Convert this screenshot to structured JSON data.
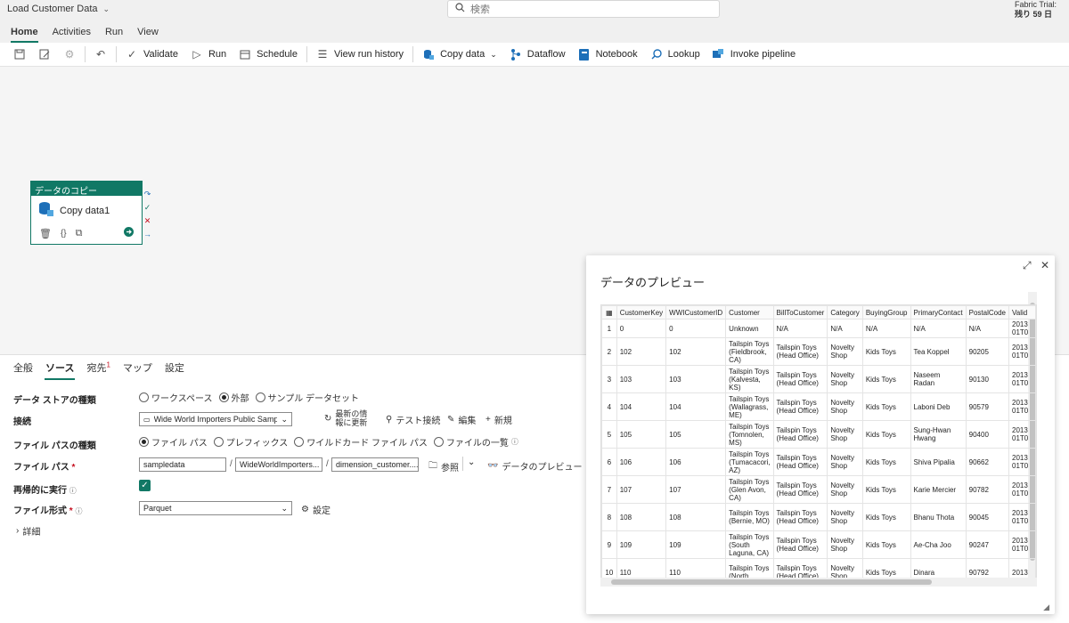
{
  "app": {
    "title": "Load Customer Data",
    "search_placeholder": "検索",
    "trial_label": "Fabric Trial:",
    "trial_days": "残り 59 日"
  },
  "tabs": [
    "Home",
    "Activities",
    "Run",
    "View"
  ],
  "toolbar": {
    "validate": "Validate",
    "run": "Run",
    "schedule": "Schedule",
    "view_run_history": "View run history",
    "copy_data": "Copy data",
    "dataflow": "Dataflow",
    "notebook": "Notebook",
    "lookup": "Lookup",
    "invoke_pipeline": "Invoke pipeline"
  },
  "activity": {
    "header": "データのコピー",
    "name": "Copy data1"
  },
  "panel": {
    "tabs": [
      "全般",
      "ソース",
      "宛先",
      "マップ",
      "設定"
    ],
    "dest_badge": "1",
    "store_type_label": "データ ストアの種類",
    "store_types": [
      "ワークスペース",
      "外部",
      "サンプル データセット"
    ],
    "connection_label": "接続",
    "connection_value": "Wide World Importers Public Sample",
    "refresh_label_1": "最新の情",
    "refresh_label_2": "報に更新",
    "test_connection": "テスト接続",
    "edit": "編集",
    "new": "新規",
    "file_path_type_label": "ファイル パスの種類",
    "file_path_types": [
      "ファイル パス",
      "プレフィックス",
      "ワイルドカード ファイル パス",
      "ファイルの一覧"
    ],
    "file_path_label": "ファイル パス",
    "file_path_1": "sampledata",
    "file_path_2": "WideWorldImporters...",
    "file_path_3": "dimension_customer....",
    "browse": "参照",
    "data_preview": "データのプレビュー",
    "recursive_label": "再帰的に実行",
    "file_format_label": "ファイル形式",
    "file_format_value": "Parquet",
    "settings": "設定",
    "details": "詳細"
  },
  "preview": {
    "title": "データのプレビュー",
    "columns": [
      "CustomerKey",
      "WWICustomerID",
      "Customer",
      "BillToCustomer",
      "Category",
      "BuyingGroup",
      "PrimaryContact",
      "PostalCode",
      "Valid"
    ],
    "rows": [
      [
        "1",
        "0",
        "0",
        "Unknown",
        "N/A",
        "N/A",
        "N/A",
        "N/A",
        "N/A",
        "2013 01T0"
      ],
      [
        "2",
        "102",
        "102",
        "Tailspin Toys (Fieldbrook, CA)",
        "Tailspin Toys (Head Office)",
        "Novelty Shop",
        "Kids Toys",
        "Tea Koppel",
        "90205",
        "2013 01T0"
      ],
      [
        "3",
        "103",
        "103",
        "Tailspin Toys (Kalvesta, KS)",
        "Tailspin Toys (Head Office)",
        "Novelty Shop",
        "Kids Toys",
        "Naseem Radan",
        "90130",
        "2013 01T0"
      ],
      [
        "4",
        "104",
        "104",
        "Tailspin Toys (Wallagrass, ME)",
        "Tailspin Toys (Head Office)",
        "Novelty Shop",
        "Kids Toys",
        "Laboni Deb",
        "90579",
        "2013 01T0"
      ],
      [
        "5",
        "105",
        "105",
        "Tailspin Toys (Tomnolen, MS)",
        "Tailspin Toys (Head Office)",
        "Novelty Shop",
        "Kids Toys",
        "Sung-Hwan Hwang",
        "90400",
        "2013 01T0"
      ],
      [
        "6",
        "106",
        "106",
        "Tailspin Toys (Tumacacori, AZ)",
        "Tailspin Toys (Head Office)",
        "Novelty Shop",
        "Kids Toys",
        "Shiva Pipalia",
        "90662",
        "2013 01T0"
      ],
      [
        "7",
        "107",
        "107",
        "Tailspin Toys (Glen Avon, CA)",
        "Tailspin Toys (Head Office)",
        "Novelty Shop",
        "Kids Toys",
        "Karie Mercier",
        "90782",
        "2013 01T0"
      ],
      [
        "8",
        "108",
        "108",
        "Tailspin Toys (Bernie, MO)",
        "Tailspin Toys (Head Office)",
        "Novelty Shop",
        "Kids Toys",
        "Bhanu Thota",
        "90045",
        "2013 01T0"
      ],
      [
        "9",
        "109",
        "109",
        "Tailspin Toys (South Laguna, CA)",
        "Tailspin Toys (Head Office)",
        "Novelty Shop",
        "Kids Toys",
        "Ae-Cha Joo",
        "90247",
        "2013 01T0"
      ],
      [
        "10",
        "110",
        "110",
        "Tailspin Toys (North",
        "Tailspin Toys (Head Office)",
        "Novelty Shop",
        "Kids Toys",
        "Dinara",
        "90792",
        "2013"
      ]
    ]
  },
  "colors": {
    "accent": "#117865",
    "error": "#c50f1f"
  }
}
